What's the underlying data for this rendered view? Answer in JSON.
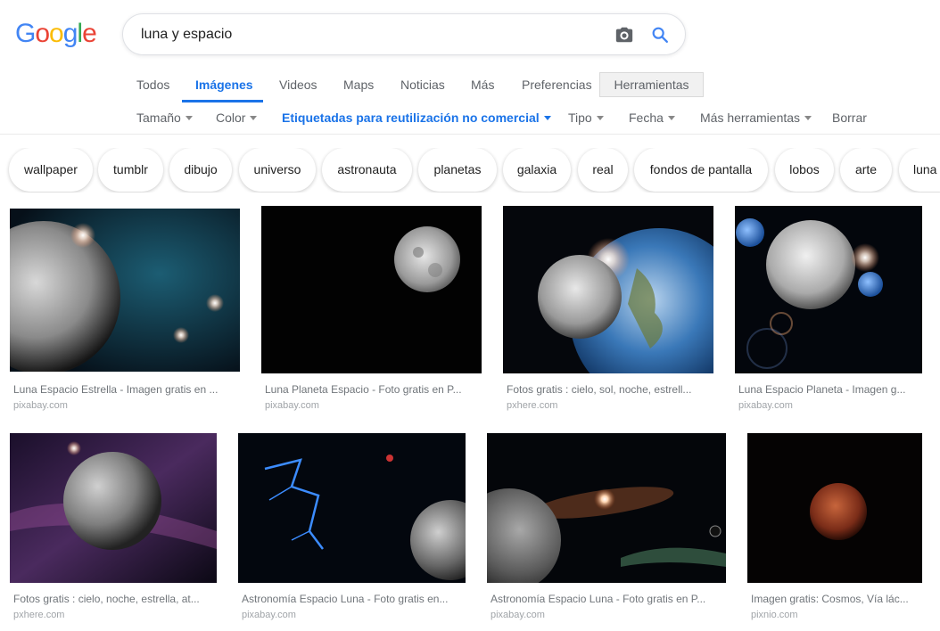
{
  "logo": {
    "text": "Google"
  },
  "search": {
    "query": "luna y espacio"
  },
  "tabs": [
    "Todos",
    "Imágenes",
    "Videos",
    "Maps",
    "Noticias",
    "Más",
    "Preferencias",
    "Herramientas"
  ],
  "tools": [
    "Tamaño",
    "Color",
    "Etiquetadas para reutilización no comercial",
    "Tipo",
    "Fecha",
    "Más herramientas",
    "Borrar"
  ],
  "chips": [
    "wallpaper",
    "tumblr",
    "dibujo",
    "universo",
    "astronauta",
    "planetas",
    "galaxia",
    "real",
    "fondos de pantalla",
    "lobos",
    "arte",
    "luna"
  ],
  "results": [
    {
      "caption": "Luna Espacio Estrella - Imagen gratis en ...",
      "domain": "pixabay.com"
    },
    {
      "caption": "Luna Planeta Espacio - Foto gratis en P...",
      "domain": "pixabay.com"
    },
    {
      "caption": "Fotos gratis : cielo, sol, noche, estrell...",
      "domain": "pxhere.com"
    },
    {
      "caption": "Luna Espacio Planeta - Imagen g...",
      "domain": "pixabay.com"
    },
    {
      "caption": "Fotos gratis : cielo, noche, estrella, at...",
      "domain": "pxhere.com"
    },
    {
      "caption": "Astronomía Espacio Luna - Foto gratis en...",
      "domain": "pixabay.com"
    },
    {
      "caption": "Astronomía Espacio Luna - Foto gratis en P...",
      "domain": "pixabay.com"
    },
    {
      "caption": "Imagen gratis: Cosmos, Vía lác...",
      "domain": "pixnio.com"
    }
  ]
}
